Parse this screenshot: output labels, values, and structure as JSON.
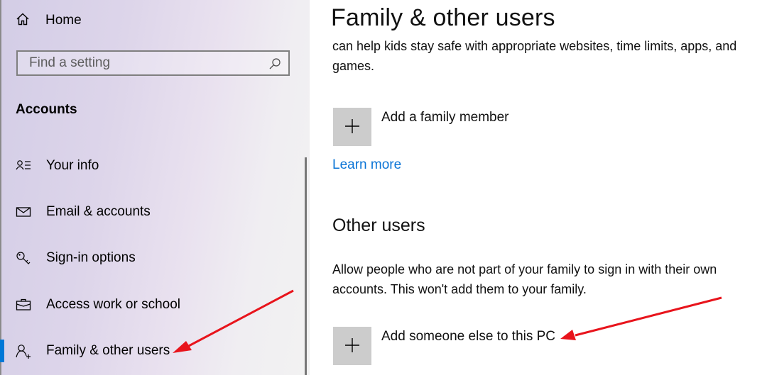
{
  "sidebar": {
    "home_label": "Home",
    "search_placeholder": "Find a setting",
    "section_header": "Accounts",
    "items": [
      {
        "label": "Your info",
        "icon": "contact-info-icon"
      },
      {
        "label": "Email & accounts",
        "icon": "mail-icon"
      },
      {
        "label": "Sign-in options",
        "icon": "key-icon"
      },
      {
        "label": "Access work or school",
        "icon": "briefcase-icon"
      },
      {
        "label": "Family & other users",
        "icon": "add-person-icon",
        "active": true
      }
    ]
  },
  "main": {
    "title": "Family & other users",
    "family_description": "can help kids stay safe with appropriate websites, time limits, apps, and games.",
    "add_family_label": "Add a family member",
    "learn_more_label": "Learn more",
    "other_users_header": "Other users",
    "other_users_description": "Allow people who are not part of your family to sign in with their own accounts. This won't add them to your family.",
    "add_other_label": "Add someone else to this PC"
  },
  "colors": {
    "accent": "#0078d7",
    "link": "#0a74d6",
    "annotation_arrow": "#e8141c",
    "plus_tile": "#cccccc"
  }
}
